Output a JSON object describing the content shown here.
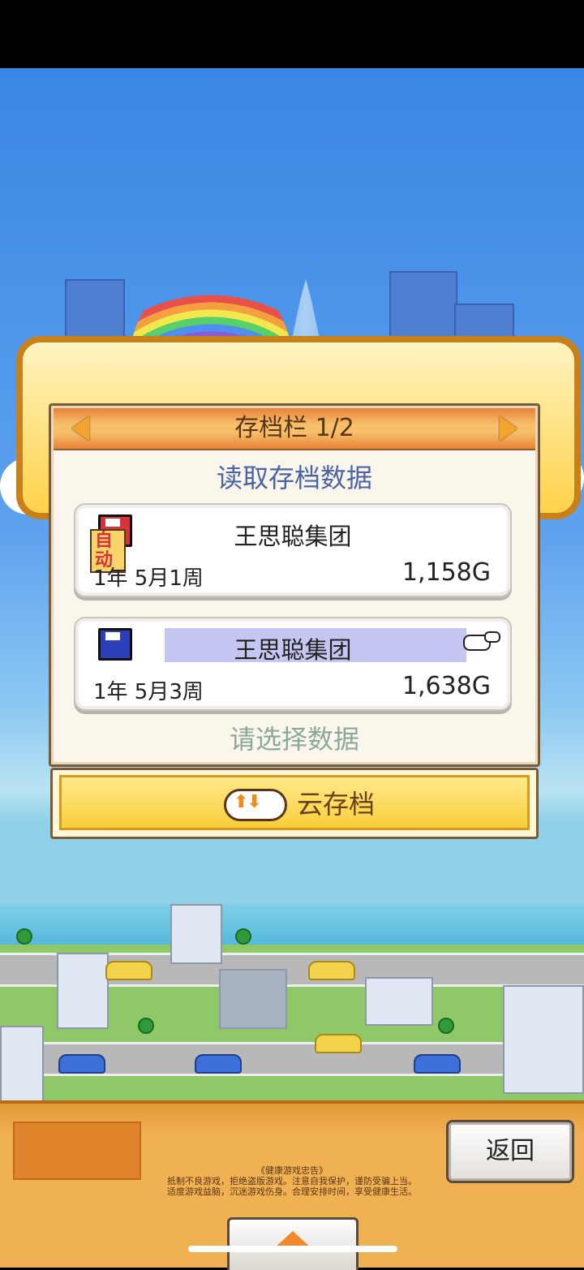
{
  "save_panel": {
    "title": "存档栏 1/2",
    "subtitle": "读取存档数据",
    "hint": "请选择数据",
    "slots": [
      {
        "auto_badge": "自动",
        "name": "王思聪集团",
        "date": "1年 5月1周",
        "money": "1,158G",
        "icon": "floppy-disk-icon"
      },
      {
        "name": "王思聪集团",
        "date": "1年 5月3周",
        "money": "1,638G",
        "icon": "floppy-disk-icon",
        "selected": true
      }
    ]
  },
  "cloud_save": {
    "label": "云存档"
  },
  "bottom": {
    "back_label": "返回",
    "notice_title": "《健康游戏忠告》",
    "notice_line1": "抵制不良游戏，拒绝盗版游戏。注意自我保护，谨防受骗上当。",
    "notice_line2": "适度游戏益脑，沉迷游戏伤身。合理安排时间，享受健康生活。"
  },
  "colors": {
    "header": "#f6c06a",
    "accent": "#4a64a8",
    "selection": "#c6c6f2"
  }
}
